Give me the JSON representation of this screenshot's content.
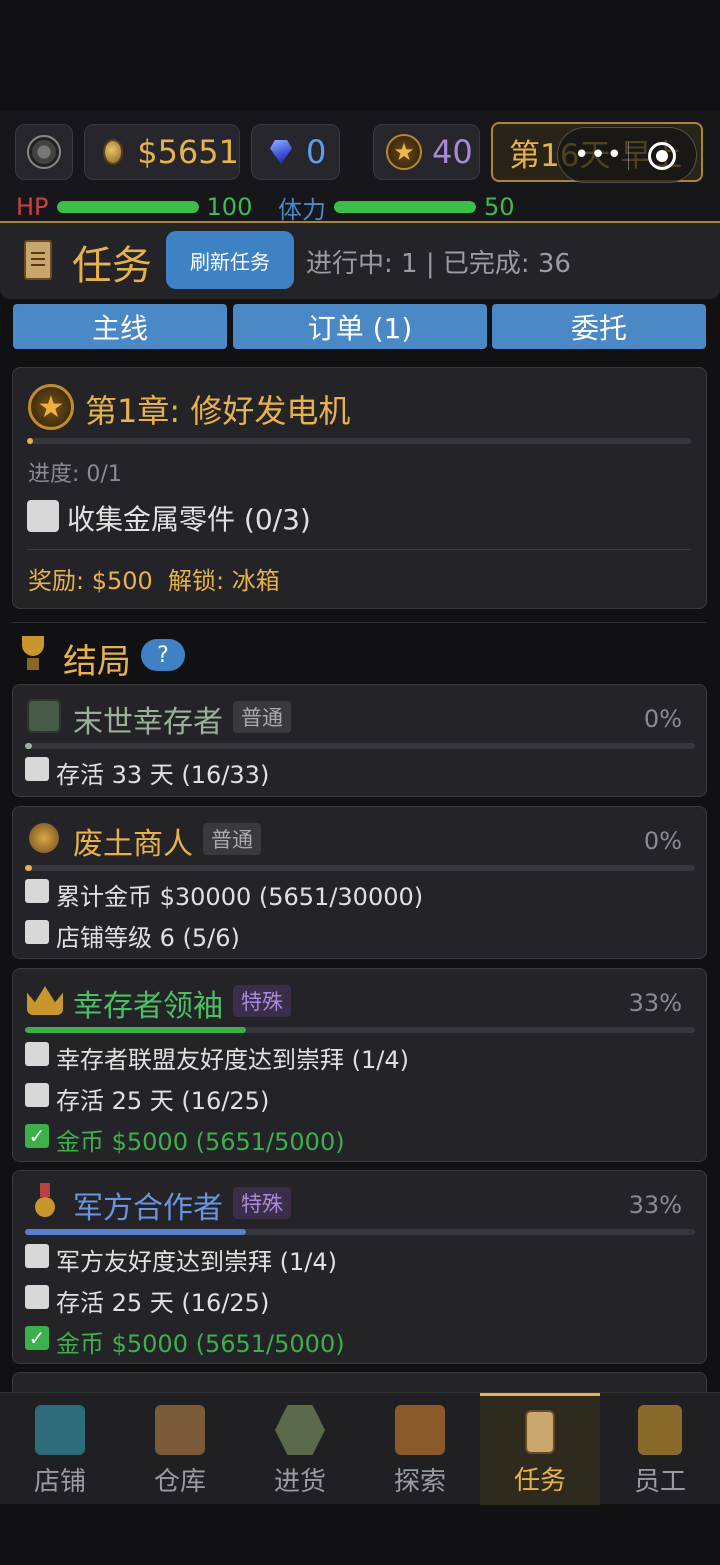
{
  "topbar": {
    "money": "$5651",
    "gems": "0",
    "stars": "40",
    "day": "第16天",
    "period": "早上",
    "hp_label": "HP",
    "hp_value": "100",
    "hp_fraction": 1.0,
    "stamina_label": "体力",
    "stamina_value": "50",
    "stamina_fraction": 1.0
  },
  "capsule": {
    "dots": "•••"
  },
  "task_header": {
    "title": "任务",
    "refresh_label": "刷新任务",
    "stats": "进行中: 1 | 已完成: 36"
  },
  "tabs": [
    "主线",
    "订单 (1)",
    "委托"
  ],
  "main_quest": {
    "title": "第1章: 修好发电机",
    "progress_label": "进度: 0/1",
    "task": "收集金属零件 (0/3)",
    "reward": "奖励: $500  解锁: 冰箱"
  },
  "endings": {
    "title": "结局",
    "help": "?",
    "items": [
      {
        "name": "末世幸存者",
        "tag": "普通",
        "percent": "0%",
        "progress": 0.0,
        "name_color": "#9ab09a",
        "conditions": [
          {
            "text": "存活 33 天 (16/33)",
            "done": false
          }
        ]
      },
      {
        "name": "废土商人",
        "tag": "普通",
        "percent": "0%",
        "progress": 0.0,
        "name_color": "#e8b24a",
        "conditions": [
          {
            "text": "累计金币 $30000 (5651/30000)",
            "done": false
          },
          {
            "text": "店铺等级 6 (5/6)",
            "done": false
          }
        ]
      },
      {
        "name": "幸存者领袖",
        "tag": "特殊",
        "percent": "33%",
        "progress": 0.33,
        "name_color": "#4cc060",
        "conditions": [
          {
            "text": "幸存者联盟友好度达到崇拜 (1/4)",
            "done": false
          },
          {
            "text": "存活 25 天 (16/25)",
            "done": false
          },
          {
            "text": "金币 $5000 (5651/5000)",
            "done": true
          }
        ]
      },
      {
        "name": "军方合作者",
        "tag": "特殊",
        "percent": "33%",
        "progress": 0.33,
        "name_color": "#6a94e0",
        "conditions": [
          {
            "text": "军方友好度达到崇拜 (1/4)",
            "done": false
          },
          {
            "text": "存活 25 天 (16/25)",
            "done": false
          },
          {
            "text": "金币 $5000 (5651/5000)",
            "done": true
          }
        ]
      }
    ]
  },
  "nav": [
    {
      "label": "店铺",
      "icon": "shop-icon",
      "color": "#2e6c7a"
    },
    {
      "label": "仓库",
      "icon": "crate-icon",
      "color": "#7a5a38"
    },
    {
      "label": "进货",
      "icon": "truck-icon",
      "color": "#5a6a4a"
    },
    {
      "label": "探索",
      "icon": "map-icon",
      "color": "#8a5a2a"
    },
    {
      "label": "任务",
      "icon": "task-scroll-icon",
      "color": "#c9a66b"
    },
    {
      "label": "员工",
      "icon": "team-icon",
      "color": "#8a6a2a"
    }
  ],
  "colors": {
    "accent": "#e8b24a",
    "tab_blue": "#4a88c6",
    "green": "#3cbf4a"
  }
}
